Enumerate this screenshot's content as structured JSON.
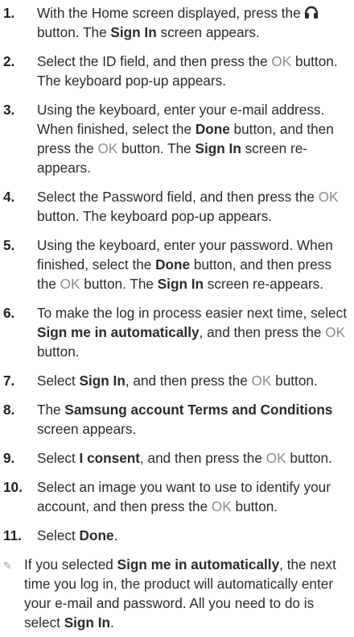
{
  "steps": [
    {
      "num": "1.",
      "parts": [
        {
          "t": "With the Home screen displayed, press the "
        },
        {
          "icon": "headset-icon"
        },
        {
          "t": " button. The "
        },
        {
          "t": "Sign In",
          "b": true
        },
        {
          "t": " screen appears."
        }
      ]
    },
    {
      "num": "2.",
      "parts": [
        {
          "t": "Select the ID field, and then press the "
        },
        {
          "t": "OK",
          "ok": true
        },
        {
          "t": " button. The keyboard pop-up appears."
        }
      ]
    },
    {
      "num": "3.",
      "parts": [
        {
          "t": "Using the keyboard, enter your e-mail address. When finished, select the "
        },
        {
          "t": "Done",
          "b": true
        },
        {
          "t": " button, and then press the "
        },
        {
          "t": "OK",
          "ok": true
        },
        {
          "t": " button. The "
        },
        {
          "t": "Sign In",
          "b": true
        },
        {
          "t": " screen re-appears."
        }
      ]
    },
    {
      "num": "4.",
      "parts": [
        {
          "t": "Select the Password field, and then press the "
        },
        {
          "t": "OK",
          "ok": true
        },
        {
          "t": " button. The keyboard pop-up appears."
        }
      ]
    },
    {
      "num": "5.",
      "parts": [
        {
          "t": "Using the keyboard, enter your password. When finished, select the "
        },
        {
          "t": "Done",
          "b": true
        },
        {
          "t": " button, and then press the "
        },
        {
          "t": "OK",
          "ok": true
        },
        {
          "t": " button. The "
        },
        {
          "t": "Sign In",
          "b": true
        },
        {
          "t": " screen re-appears."
        }
      ]
    },
    {
      "num": "6.",
      "parts": [
        {
          "t": "To make the log in process easier next time, select "
        },
        {
          "t": "Sign me in automatically",
          "b": true
        },
        {
          "t": ", and then press the "
        },
        {
          "t": "OK",
          "ok": true
        },
        {
          "t": " button."
        }
      ]
    },
    {
      "num": "7.",
      "parts": [
        {
          "t": "Select "
        },
        {
          "t": "Sign In",
          "b": true
        },
        {
          "t": ", and then press the "
        },
        {
          "t": "OK",
          "ok": true
        },
        {
          "t": " button."
        }
      ]
    },
    {
      "num": "8.",
      "parts": [
        {
          "t": "The "
        },
        {
          "t": "Samsung account Terms and Conditions",
          "b": true
        },
        {
          "t": " screen appears."
        }
      ]
    },
    {
      "num": "9.",
      "parts": [
        {
          "t": "Select "
        },
        {
          "t": "I consent",
          "b": true
        },
        {
          "t": ", and then press the "
        },
        {
          "t": "OK",
          "ok": true
        },
        {
          "t": " button."
        }
      ]
    },
    {
      "num": "10.",
      "parts": [
        {
          "t": "Select an image you want to use to identify your account, and then press the "
        },
        {
          "t": "OK",
          "ok": true
        },
        {
          "t": " button."
        }
      ]
    },
    {
      "num": "11.",
      "parts": [
        {
          "t": "Select "
        },
        {
          "t": "Done",
          "b": true
        },
        {
          "t": "."
        }
      ]
    }
  ],
  "note": {
    "icon": "pencil-note-icon",
    "parts": [
      {
        "t": "If you selected "
      },
      {
        "t": "Sign me in automatically",
        "b": true
      },
      {
        "t": ", the next time you log in, the product will automatically enter your e-mail and password. All you need to do is select "
      },
      {
        "t": "Sign In",
        "b": true
      },
      {
        "t": "."
      }
    ]
  }
}
